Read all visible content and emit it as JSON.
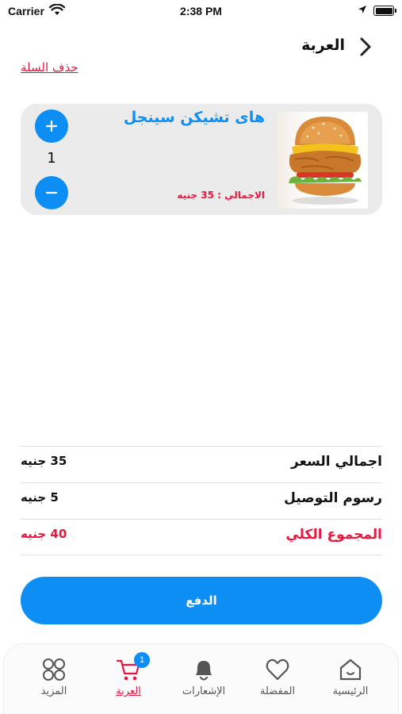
{
  "status_bar": {
    "carrier": "Carrier",
    "time": "2:38 PM"
  },
  "header": {
    "title": "العربة",
    "clear_cart": "حذف السلة"
  },
  "cart_item": {
    "name": "هاى تشيكن سينجل",
    "total": "الاجمالي : 35 جنيه",
    "quantity": "1",
    "plus_symbol": "+",
    "minus_symbol": "−"
  },
  "summary": {
    "subtotal_label": "اجمالي السعر",
    "subtotal_value": "35 جنيه",
    "delivery_label": "رسوم التوصيل",
    "delivery_value": "5 جنيه",
    "grand_total_label": "المجموع الكلي",
    "grand_total_value": "40 جنيه"
  },
  "pay_button": "الدفع",
  "tabbar": {
    "items": [
      {
        "label": "المزيد",
        "icon": "grid-icon"
      },
      {
        "label": "العربة",
        "icon": "cart-icon",
        "badge": "1",
        "active": true
      },
      {
        "label": "الإشعارات",
        "icon": "bell-icon"
      },
      {
        "label": "المفضلة",
        "icon": "heart-icon"
      },
      {
        "label": "الرئيسية",
        "icon": "home-icon"
      }
    ]
  },
  "colors": {
    "accent": "#0d8ef5",
    "danger": "#e8173e",
    "card": "#ebebeb"
  }
}
